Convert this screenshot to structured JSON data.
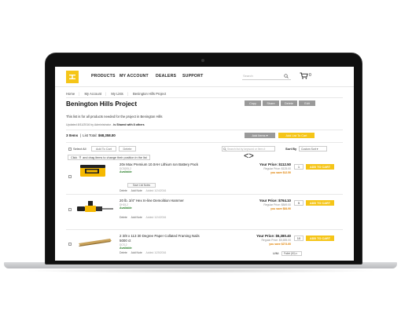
{
  "header": {
    "nav": [
      "PRODUCTS",
      "MY ACCOUNT",
      "DEALERS",
      "SUPPORT"
    ],
    "search_placeholder": "Search",
    "cart_count": "0"
  },
  "breadcrumb": [
    "Home",
    "My Account",
    "My Lists",
    "Benington Hills Project"
  ],
  "list": {
    "title": "Benington Hills Project",
    "actions": [
      "Copy",
      "Share",
      "Delete",
      "Edit"
    ],
    "description": "This list is for all products needed for the project in Benington Hills",
    "updated": "Updated 8/11/2016 by Administrator",
    "shared": "is Shared with 8 others",
    "items_count": "3 Items",
    "list_total_label": "List Total:",
    "list_total_value": "$68,358.80",
    "add_items": "Add Items",
    "add_list_to_cart": "Add List To Cart"
  },
  "toolbar": {
    "select_all": "Select All",
    "add_to_cart": "Add To Cart",
    "delete": "Delete",
    "search_placeholder": "Search list by keyword or Item #",
    "sort_label": "Sort By",
    "sort_value": "Custom Sort",
    "drag_tip_prefix": "Click",
    "drag_tip": "and drag items to change their position in the list"
  },
  "items": [
    {
      "name": "20v Max Premium 10.0AH Lithium Ion Battery Pack",
      "sku": "DCB205-2",
      "availability": "Available",
      "note_button": "Save List Notes",
      "delete": "Delete",
      "add_note": "Add Note",
      "added": "Added 1/24/2016",
      "your_price": "Your Price: $112.50",
      "regular": "Regular Price: $125.00",
      "you_save": "you save $12.50",
      "qty": "1",
      "add_to_cart": "ADD TO CART"
    },
    {
      "name": "20 lb. 3/4\" Hex In-line Demolition Hammer",
      "sku": "DH15-2",
      "availability": "Available",
      "delete": "Delete",
      "add_note": "Add Note",
      "added": "Added 1/24/2016",
      "your_price": "Your Price: $764.10",
      "regular": "Regular Price: $849.00",
      "you_save": "you save $84.90",
      "qty": "5",
      "add_to_cart": "ADD TO CART"
    },
    {
      "name": "2 3/8 x 113 30 Degree Paper Collated Framing Nails 5000 ct",
      "sku": "DCS-2",
      "availability": "Available",
      "delete": "Delete",
      "add_note": "Add Note",
      "added": "Added 1/25/2016",
      "your_price": "Your Price: $5,380.40",
      "regular": "Regular Price: $5,655.00",
      "you_save": "you save $274.60",
      "qty": "10",
      "add_to_cart": "ADD TO CART",
      "uom_label": "U/M:",
      "uom_value": "Pallet (50)"
    }
  ]
}
